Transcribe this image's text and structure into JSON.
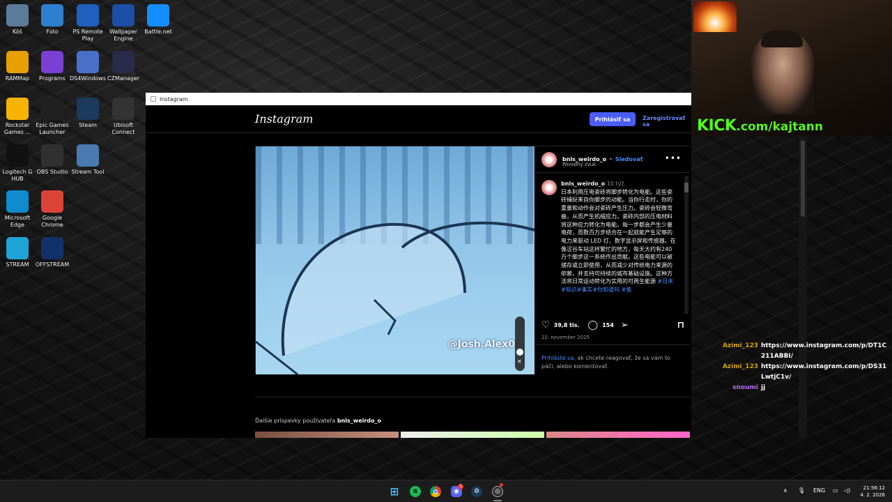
{
  "desktop": {
    "icons": [
      {
        "label": "Kôš",
        "icon": "recycle-bin-icon",
        "color": "#5b7c99"
      },
      {
        "label": "Foto",
        "icon": "photos-icon",
        "color": "#2f7fd1"
      },
      {
        "label": "PS Remote Play",
        "icon": "ps-remote-play-icon",
        "color": "#1f5fbf"
      },
      {
        "label": "Wallpaper Engine",
        "icon": "wallpaper-engine-icon",
        "color": "#1b4fa8"
      },
      {
        "label": "Battle.net",
        "icon": "battlenet-icon",
        "color": "#148eff"
      },
      {
        "label": "RAMMap",
        "icon": "rammap-icon",
        "color": "#e8a000"
      },
      {
        "label": "Programs",
        "icon": "programs-folder-icon",
        "color": "#7b3fd6"
      },
      {
        "label": "DS4Windows",
        "icon": "ds4windows-icon",
        "color": "#4a6fc9"
      },
      {
        "label": "CZManager",
        "icon": "czmanager-icon",
        "color": "#2a2a4a"
      },
      {
        "label": "Rockstar Games ...",
        "icon": "rockstar-icon",
        "color": "#f6b400"
      },
      {
        "label": "Epic Games Launcher",
        "icon": "epic-games-icon",
        "color": "#202020"
      },
      {
        "label": "Steam",
        "icon": "steam-icon",
        "color": "#1b3a5c"
      },
      {
        "label": "Ubisoft Connect",
        "icon": "ubisoft-icon",
        "color": "#333"
      },
      {
        "label": "Logitech G HUB",
        "icon": "logitech-icon",
        "color": "#111"
      },
      {
        "label": "OBS Studio",
        "icon": "obs-icon",
        "color": "#303030"
      },
      {
        "label": "Stream Tool",
        "icon": "gear-icon",
        "color": "#4a7ab0"
      },
      {
        "label": "Microsoft Edge",
        "icon": "edge-icon",
        "color": "#0f8bd0"
      },
      {
        "label": "Google Chrome",
        "icon": "chrome-icon",
        "color": "#db4437"
      },
      {
        "label": "STREAM",
        "icon": "stream-shortcut-icon",
        "color": "#1fa3d6"
      },
      {
        "label": "OFFSTREAM",
        "icon": "offstream-shortcut-icon",
        "color": "#12306a"
      }
    ]
  },
  "window": {
    "title": "Instagram"
  },
  "instagram": {
    "logo": "Instagram",
    "login_button": "Prihlásiť sa",
    "register_link": "Zaregistrovať sa",
    "post": {
      "username": "bnls_weirdo_o",
      "separator": "•",
      "follow": "Sledovať",
      "audio": "Pôvodný zvuk",
      "more": "•••",
      "caption_user": "bnls_weirdo_o",
      "caption_time": "10 týž.",
      "caption_text": "日本利用压电瓷砖将脚步转化为电能。这些瓷砖捕捉来自你脚步的动能。当你行走时，你的重量和动作会对瓷砖产生压力。瓷砖会轻微弯曲，从而产生机械应力。瓷砖内部的压电材料将这种应力转化为电能。每一步都会产生少量电荷，而数百万步结合在一起就能产生足够的电力来驱动 LED 灯、数字显示屏和传感器。在像涩谷车站这样繁忙的地方，每天大约有240万个脚步这一系统作出贡献。这些电能可以被储存或立即使用，从而减少对传统电力来源的依赖，并支持可持续的城市基础设施。这种方法将日常运动转化为实用的可再生能源",
      "caption_tags": "#日本#知识#事实#你知道吗 #推",
      "watermark": "@Josh.Alex0",
      "likes": "39,8 tis.",
      "comments": "154",
      "date": "22. november 2025",
      "login_link": "Prihláste sa,",
      "login_hint": " ak chcete reagovať, že sa vám to páči, alebo komentovať."
    },
    "more_posts_prefix": "Ďalšie príspevky používateľa ",
    "more_posts_user": "bnls_weirdo_o"
  },
  "overlay": {
    "kick_logo": "KICK",
    "kick_url": ".com/kajtann"
  },
  "chat": [
    {
      "user": "Azimi_123",
      "message": "https://www.instagram.com/p/DT1C211ABBI/"
    },
    {
      "user": "Azimi_123",
      "message": "https://www.instagram.com/p/DS31LwtjC1v/"
    },
    {
      "user": "snoumi",
      "message": "jj"
    }
  ],
  "taskbar": {
    "apps": [
      "windows-start-icon",
      "spotify-icon",
      "chrome-icon",
      "discord-icon",
      "steam-icon",
      "obs-icon"
    ],
    "discord_badge": "1",
    "language": "ENG",
    "time": "21:56:12",
    "date": "4. 2. 2026"
  }
}
